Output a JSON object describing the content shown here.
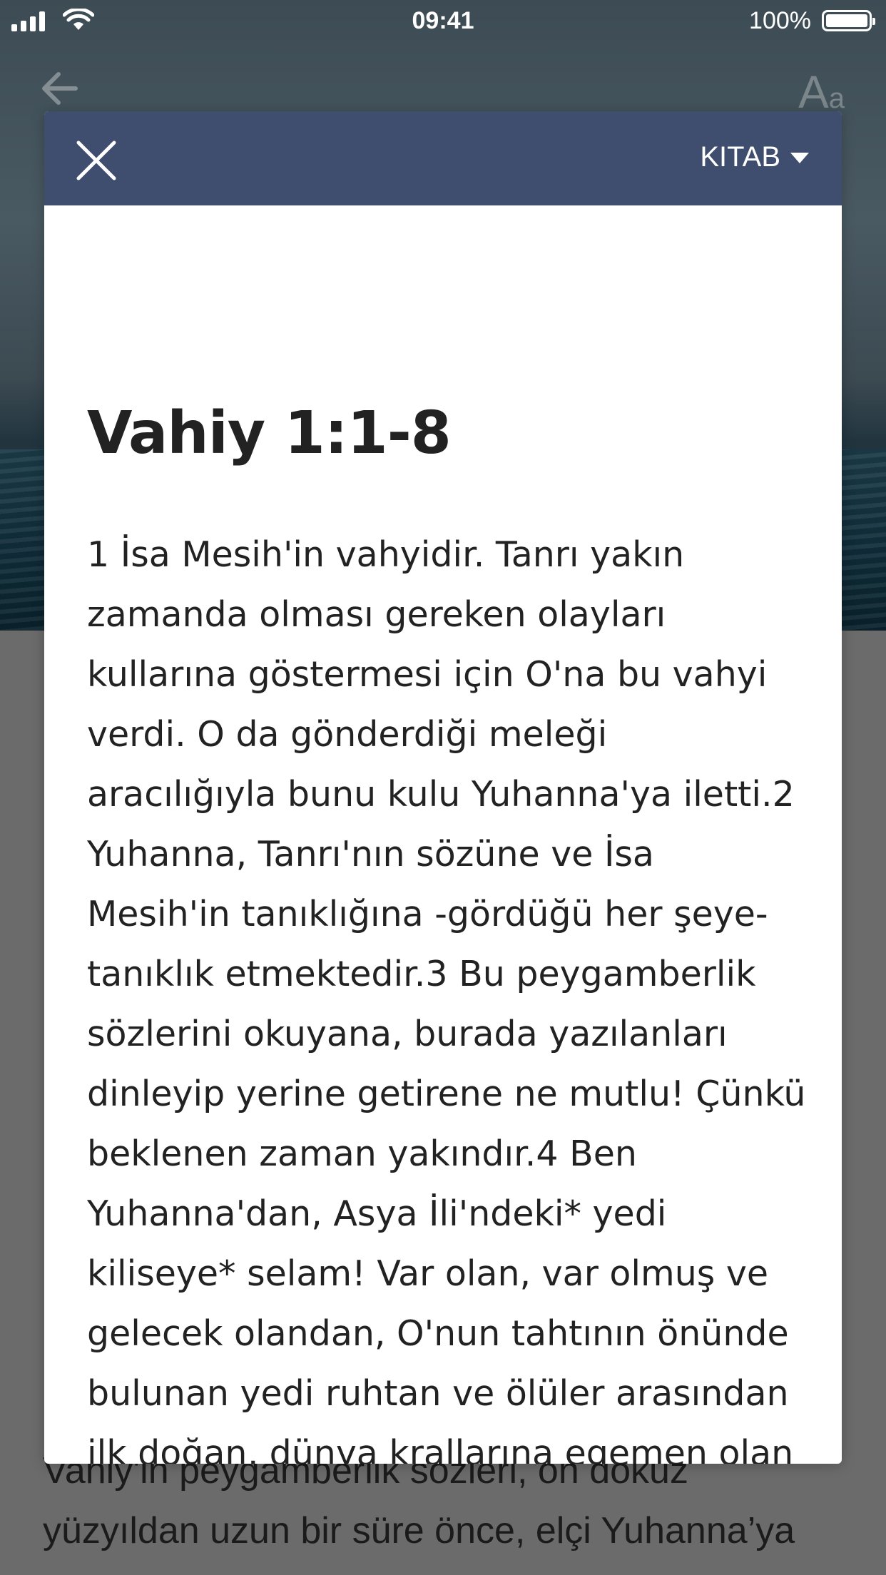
{
  "status_bar": {
    "time": "09:41",
    "battery": "100%"
  },
  "background_app": {
    "back_icon": "arrow-left-icon",
    "font_icon_big": "A",
    "font_icon_small": "a",
    "text_line1": "Vahiy'in peygamberlik sözleri, on dokuz",
    "text_line2": "yüzyıldan uzun bir süre önce, elçi Yuhanna’ya"
  },
  "modal": {
    "close_icon": "close-icon",
    "book_label": "KITAB",
    "title": "Vahiy 1:1-8",
    "text": "1 İsa Mesih'in vahyidir. Tanrı yakın zamanda olması gereken olayları kullarına göstermesi için O'na bu vahyi verdi. O da gönderdiği meleği aracılığıyla bunu kulu Yuhanna'ya iletti.2 Yuhanna, Tanrı'nın sözüne ve İsa Mesih'in tanıklığına -gördüğü her şeye- tanıklık etmektedir.3 Bu peygamberlik sözlerini okuyana, burada yazılanları dinleyip yerine getirene ne mutlu! Çünkü beklenen zaman yakındır.4 Ben Yuhanna'dan, Asya İli'ndeki* yedi kiliseye* selam! Var olan, var olmuş ve gelecek olandan, O'nun tahtının önünde bulunan yedi ruhtan ve ölüler arasından ilk doğan, dünya krallarına egemen olan güvenilir tanık İsa Mesih'ten sizlere lütuf ve esenlik olsun. Yücelik ve güç"
  },
  "colors": {
    "header": "#3f4d6e",
    "overlay": "#6b6b6b",
    "text": "#222222"
  }
}
